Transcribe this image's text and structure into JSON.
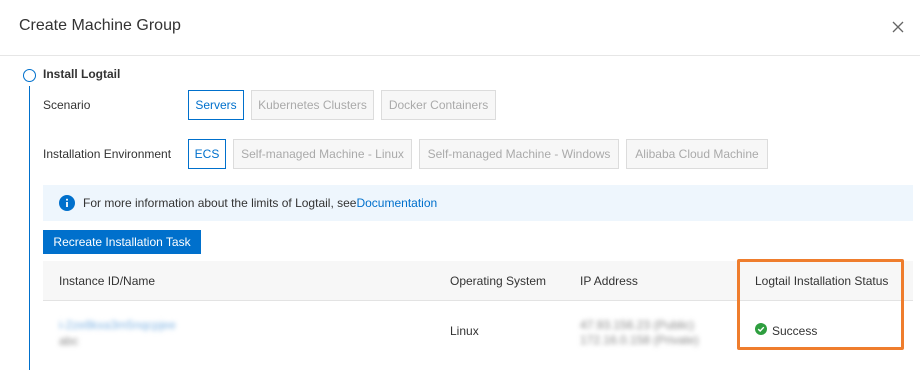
{
  "dialog": {
    "title": "Create Machine Group"
  },
  "step": {
    "title": "Install Logtail"
  },
  "scenario": {
    "label": "Scenario",
    "options": [
      "Servers",
      "Kubernetes Clusters",
      "Docker Containers"
    ],
    "selected": "Servers"
  },
  "environment": {
    "label": "Installation Environment",
    "options": [
      "ECS",
      "Self-managed Machine - Linux",
      "Self-managed Machine - Windows",
      "Alibaba Cloud Machine"
    ],
    "selected": "ECS"
  },
  "notice": {
    "icon": "info-icon",
    "text": "For more information about the limits of Logtail, see",
    "link": "Documentation"
  },
  "actions": {
    "recreate_label": "Recreate Installation Task"
  },
  "table": {
    "headers": [
      "Instance ID/Name",
      "Operating System",
      "IP Address",
      "Logtail Installation Status"
    ],
    "rows": [
      {
        "os": "Linux",
        "status": "Success"
      }
    ]
  },
  "colors": {
    "accent": "#0070cc",
    "success": "#2e9e3f",
    "highlight": "#ef7d2d",
    "notice_bg": "#eef6fd"
  }
}
